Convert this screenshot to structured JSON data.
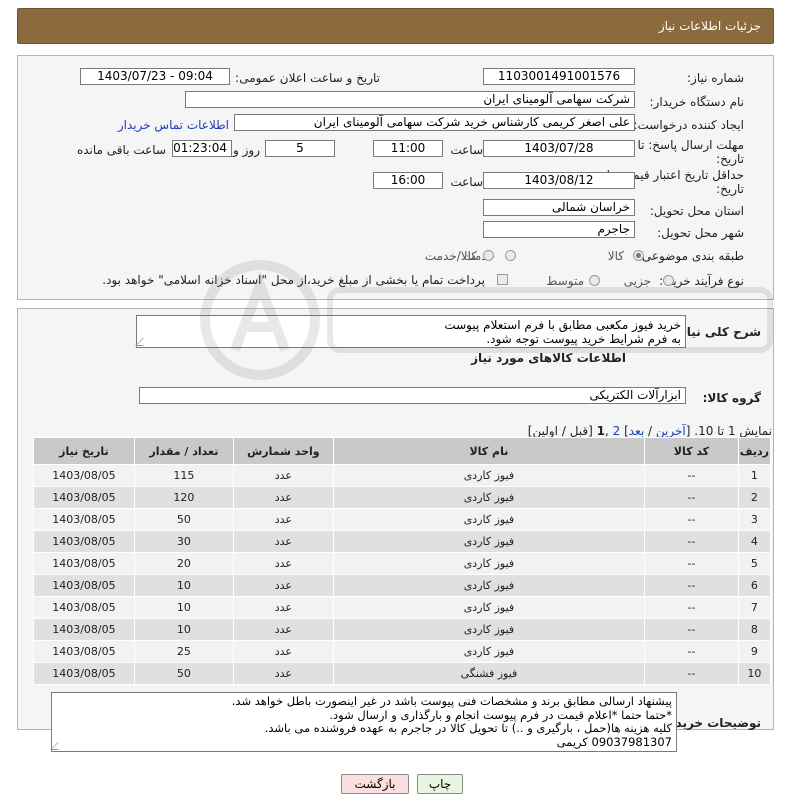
{
  "header": {
    "title": "جزئیات اطلاعات نیاز"
  },
  "form": {
    "need_number_label": "شماره نیاز:",
    "need_number": "1103001491001576",
    "announce_label": "تاریخ و ساعت اعلان عمومی:",
    "announce_value": "1403/07/23 - 09:04",
    "buyer_org_label": "نام دستگاه خریدار:",
    "buyer_org": "شرکت سهامی آلومینای ایران",
    "creator_label": "ایجاد کننده درخواست:",
    "creator": "علی اصغر کریمی کارشناس خرید شرکت سهامی آلومینای ایران",
    "contact_link": "اطلاعات تماس خریدار",
    "deadline_label_1": "مهلت ارسال پاسخ: تا",
    "deadline_label_2": "تاریخ:",
    "deadline_date": "1403/07/28",
    "time_label": "ساعت",
    "deadline_time": "11:00",
    "days_value": "5",
    "days_label": "روز و",
    "remaining_time": "01:23:04",
    "remaining_label": "ساعت باقی مانده",
    "validity_label_1": "حداقل تاریخ اعتبار قیمت: تا",
    "validity_label_2": "تاریخ:",
    "validity_date": "1403/08/12",
    "validity_time_label": "ساعت",
    "validity_time": "16:00",
    "province_label": "استان محل تحویل:",
    "province": "خراسان شمالی",
    "city_label": "شهر محل تحویل:",
    "city": "جاجرم",
    "category_label": "طبقه بندی موضوعی:",
    "category_options": [
      "کالا",
      "خدمت",
      "کالا/خدمت"
    ],
    "process_label": "نوع فرآیند خرید :",
    "process_options": [
      "جزیی",
      "متوسط"
    ],
    "payment_note": "پرداخت تمام یا بخشی از مبلغ خرید،از محل \"اسناد خزانه اسلامی\" خواهد بود."
  },
  "description": {
    "label": "شرح کلی نیاز:",
    "text": "خرید فیوز مکعبی مطابق با فرم استعلام پیوست\nبه فرم شرایط خرید پیوست توجه شود."
  },
  "goods": {
    "section_title": "اطلاعات کالاهای مورد نیاز",
    "group_label": "گروه کالا:",
    "group_value": "ابزارآلات الکتریکی"
  },
  "pagination": {
    "prefix": "نمایش 1 تا 10. [",
    "last": "آخرین",
    "sep1": " / ",
    "next": "بعد",
    "close1": "] ",
    "page2": "2",
    "comma": " ,",
    "page1": "1",
    "rest": " [قبل / اولین]"
  },
  "table": {
    "headers": [
      "ردیف",
      "کد کالا",
      "نام کالا",
      "واحد شمارش",
      "تعداد / مقدار",
      "تاریخ نیاز"
    ],
    "rows": [
      [
        "1",
        "--",
        "فیوز کاردی",
        "عدد",
        "115",
        "1403/08/05"
      ],
      [
        "2",
        "--",
        "فیوز کاردی",
        "عدد",
        "120",
        "1403/08/05"
      ],
      [
        "3",
        "--",
        "فیوز کاردی",
        "عدد",
        "50",
        "1403/08/05"
      ],
      [
        "4",
        "--",
        "فیوز کاردی",
        "عدد",
        "30",
        "1403/08/05"
      ],
      [
        "5",
        "--",
        "فیوز کاردی",
        "عدد",
        "20",
        "1403/08/05"
      ],
      [
        "6",
        "--",
        "فیوز کاردی",
        "عدد",
        "10",
        "1403/08/05"
      ],
      [
        "7",
        "--",
        "فیوز کاردی",
        "عدد",
        "10",
        "1403/08/05"
      ],
      [
        "8",
        "--",
        "فیوز کاردی",
        "عدد",
        "10",
        "1403/08/05"
      ],
      [
        "9",
        "--",
        "فیوز کاردی",
        "عدد",
        "25",
        "1403/08/05"
      ],
      [
        "10",
        "--",
        "فیوز فشنگی",
        "عدد",
        "50",
        "1403/08/05"
      ]
    ]
  },
  "buyer_notes": {
    "label": "توضیحات خریدار:",
    "text": "پیشنهاد ارسالی مطابق برند و مشخصات فنی پیوست باشد در غیر اینصورت باطل خواهد شد.\n*حتما حتما *اعلام قیمت در فرم پیوست انجام و بارگذاری و ارسال شود.\nکلیه هزینه ها(حمل ، بارگیری و ..) تا تحویل کالا در جاجرم به عهده فروشنده می باشد.\n09037981307 کریمی"
  },
  "buttons": {
    "print": "چاپ",
    "back": "بازگشت"
  },
  "colors": {
    "header_bg": "#8b6b3e",
    "link": "#1a3fb8",
    "table_header": "#c9c9c9"
  }
}
